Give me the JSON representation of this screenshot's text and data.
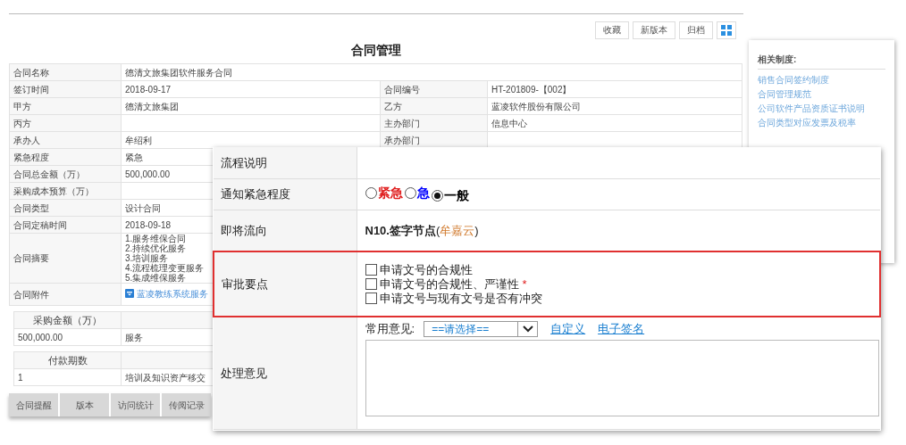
{
  "main_window": {
    "toolbar_buttons": [
      "收藏",
      "新版本",
      "归档"
    ],
    "title": "合同管理",
    "rows": [
      {
        "kind": "text",
        "label": "合同名称",
        "value": "德清文旅集团软件服务合同"
      },
      {
        "kind": "text",
        "label": "签订时间",
        "value": "2018-09-17",
        "label_2": "合同编号",
        "value_2": "HT-201809-【002】"
      },
      {
        "kind": "text",
        "label": "甲方",
        "value": "德清文旅集团",
        "label_2": "乙方",
        "value_2": "蓝凌软件股份有限公司"
      },
      {
        "kind": "text",
        "label": "丙方",
        "label_2": "主办部门",
        "value_2": "信息中心"
      },
      {
        "kind": "text",
        "label": "承办人",
        "value": "牟绍利",
        "label_2": "承办部门"
      },
      {
        "kind": "text",
        "label": "紧急程度",
        "value": "紧急"
      },
      {
        "kind": "text",
        "label": "合同总金额（万）",
        "value": "500,000.00"
      },
      {
        "kind": "text",
        "label": "采购成本预算（万）"
      },
      {
        "kind": "text",
        "label": "合同类型",
        "value": "设计合同"
      },
      {
        "kind": "text",
        "label": "合同定稿时间",
        "value": "2018-09-18"
      },
      {
        "kind": "lines",
        "label": "合同摘要",
        "lines": [
          "1.服务维保合同",
          "2.持续优化服务",
          "3.培训服务",
          "4.流程梳理变更服务",
          "5.集成维保服务"
        ]
      },
      {
        "kind": "attachment",
        "label": "合同附件",
        "value": "蓝凌教练系统服务"
      }
    ],
    "sub_tables": [
      {
        "header": "采购金额（万）",
        "rows": [
          [
            "500,000.00",
            "服务"
          ]
        ]
      },
      {
        "header": "付款期数",
        "rows": [
          [
            "1",
            "培训及知识资产移交"
          ]
        ]
      }
    ],
    "bottom_tabs": [
      {
        "label": "合同提醒",
        "selected": false
      },
      {
        "label": "版本",
        "selected": false
      },
      {
        "label": "访问统计",
        "selected": false
      },
      {
        "label": "传阅记录",
        "selected": false
      }
    ]
  },
  "side_panel": {
    "heading": "相关制度:",
    "links": [
      "销售合同签约制度",
      "合同管理规范",
      "公司软件产品资质证书说明",
      "合同类型对应发票及税率"
    ]
  },
  "form": {
    "rows": [
      {
        "kind": "blank",
        "label": "流程说明"
      },
      {
        "kind": "radios",
        "label": "通知紧急程度",
        "options": [
          {
            "label": "紧急",
            "color": "#e02020",
            "selected": false
          },
          {
            "label": "急",
            "color": "#0000ff",
            "selected": false
          },
          {
            "label": "一般",
            "color": "#000000",
            "selected": true
          }
        ]
      },
      {
        "kind": "flow",
        "label": "即将流向",
        "node": "N10.签字节点",
        "person_open": "(",
        "person": "牟嘉云",
        "person_close": ")"
      },
      {
        "kind": "checks",
        "label": "审批要点",
        "highlighted": true,
        "items": [
          {
            "label": "申请文号的合规性",
            "checked": false
          },
          {
            "label": "申请文号的合规性、严谨性",
            "checked": false,
            "required_mark": "*"
          },
          {
            "label": "申请文号与现有文号是否有冲突",
            "checked": false
          }
        ]
      },
      {
        "kind": "opinion",
        "label": "处理意见",
        "common_label": "常用意见:",
        "select_value": "==请选择==",
        "links": [
          "自定义",
          "电子签名"
        ]
      }
    ]
  }
}
